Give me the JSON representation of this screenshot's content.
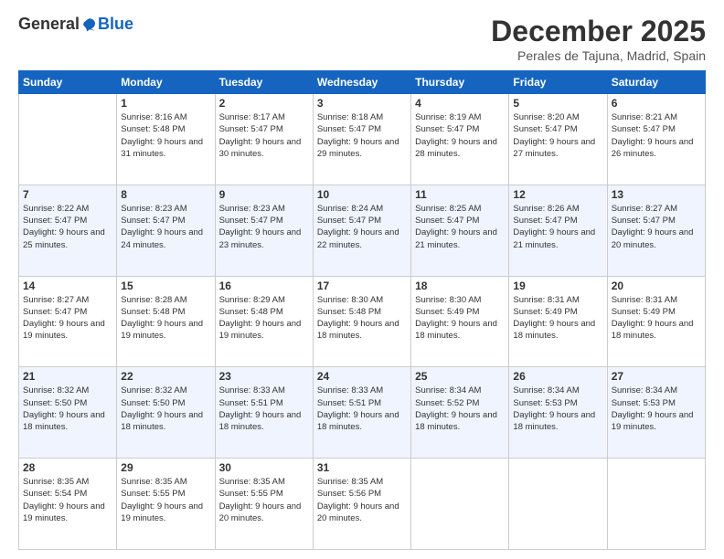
{
  "logo": {
    "general": "General",
    "blue": "Blue"
  },
  "header": {
    "month": "December 2025",
    "location": "Perales de Tajuna, Madrid, Spain"
  },
  "weekdays": [
    "Sunday",
    "Monday",
    "Tuesday",
    "Wednesday",
    "Thursday",
    "Friday",
    "Saturday"
  ],
  "weeks": [
    [
      {
        "day": "",
        "sunrise": "",
        "sunset": "",
        "daylight": "",
        "empty": true
      },
      {
        "day": "1",
        "sunrise": "Sunrise: 8:16 AM",
        "sunset": "Sunset: 5:48 PM",
        "daylight": "Daylight: 9 hours and 31 minutes."
      },
      {
        "day": "2",
        "sunrise": "Sunrise: 8:17 AM",
        "sunset": "Sunset: 5:47 PM",
        "daylight": "Daylight: 9 hours and 30 minutes."
      },
      {
        "day": "3",
        "sunrise": "Sunrise: 8:18 AM",
        "sunset": "Sunset: 5:47 PM",
        "daylight": "Daylight: 9 hours and 29 minutes."
      },
      {
        "day": "4",
        "sunrise": "Sunrise: 8:19 AM",
        "sunset": "Sunset: 5:47 PM",
        "daylight": "Daylight: 9 hours and 28 minutes."
      },
      {
        "day": "5",
        "sunrise": "Sunrise: 8:20 AM",
        "sunset": "Sunset: 5:47 PM",
        "daylight": "Daylight: 9 hours and 27 minutes."
      },
      {
        "day": "6",
        "sunrise": "Sunrise: 8:21 AM",
        "sunset": "Sunset: 5:47 PM",
        "daylight": "Daylight: 9 hours and 26 minutes."
      }
    ],
    [
      {
        "day": "7",
        "sunrise": "Sunrise: 8:22 AM",
        "sunset": "Sunset: 5:47 PM",
        "daylight": "Daylight: 9 hours and 25 minutes."
      },
      {
        "day": "8",
        "sunrise": "Sunrise: 8:23 AM",
        "sunset": "Sunset: 5:47 PM",
        "daylight": "Daylight: 9 hours and 24 minutes."
      },
      {
        "day": "9",
        "sunrise": "Sunrise: 8:23 AM",
        "sunset": "Sunset: 5:47 PM",
        "daylight": "Daylight: 9 hours and 23 minutes."
      },
      {
        "day": "10",
        "sunrise": "Sunrise: 8:24 AM",
        "sunset": "Sunset: 5:47 PM",
        "daylight": "Daylight: 9 hours and 22 minutes."
      },
      {
        "day": "11",
        "sunrise": "Sunrise: 8:25 AM",
        "sunset": "Sunset: 5:47 PM",
        "daylight": "Daylight: 9 hours and 21 minutes."
      },
      {
        "day": "12",
        "sunrise": "Sunrise: 8:26 AM",
        "sunset": "Sunset: 5:47 PM",
        "daylight": "Daylight: 9 hours and 21 minutes."
      },
      {
        "day": "13",
        "sunrise": "Sunrise: 8:27 AM",
        "sunset": "Sunset: 5:47 PM",
        "daylight": "Daylight: 9 hours and 20 minutes."
      }
    ],
    [
      {
        "day": "14",
        "sunrise": "Sunrise: 8:27 AM",
        "sunset": "Sunset: 5:47 PM",
        "daylight": "Daylight: 9 hours and 19 minutes."
      },
      {
        "day": "15",
        "sunrise": "Sunrise: 8:28 AM",
        "sunset": "Sunset: 5:48 PM",
        "daylight": "Daylight: 9 hours and 19 minutes."
      },
      {
        "day": "16",
        "sunrise": "Sunrise: 8:29 AM",
        "sunset": "Sunset: 5:48 PM",
        "daylight": "Daylight: 9 hours and 19 minutes."
      },
      {
        "day": "17",
        "sunrise": "Sunrise: 8:30 AM",
        "sunset": "Sunset: 5:48 PM",
        "daylight": "Daylight: 9 hours and 18 minutes."
      },
      {
        "day": "18",
        "sunrise": "Sunrise: 8:30 AM",
        "sunset": "Sunset: 5:49 PM",
        "daylight": "Daylight: 9 hours and 18 minutes."
      },
      {
        "day": "19",
        "sunrise": "Sunrise: 8:31 AM",
        "sunset": "Sunset: 5:49 PM",
        "daylight": "Daylight: 9 hours and 18 minutes."
      },
      {
        "day": "20",
        "sunrise": "Sunrise: 8:31 AM",
        "sunset": "Sunset: 5:49 PM",
        "daylight": "Daylight: 9 hours and 18 minutes."
      }
    ],
    [
      {
        "day": "21",
        "sunrise": "Sunrise: 8:32 AM",
        "sunset": "Sunset: 5:50 PM",
        "daylight": "Daylight: 9 hours and 18 minutes."
      },
      {
        "day": "22",
        "sunrise": "Sunrise: 8:32 AM",
        "sunset": "Sunset: 5:50 PM",
        "daylight": "Daylight: 9 hours and 18 minutes."
      },
      {
        "day": "23",
        "sunrise": "Sunrise: 8:33 AM",
        "sunset": "Sunset: 5:51 PM",
        "daylight": "Daylight: 9 hours and 18 minutes."
      },
      {
        "day": "24",
        "sunrise": "Sunrise: 8:33 AM",
        "sunset": "Sunset: 5:51 PM",
        "daylight": "Daylight: 9 hours and 18 minutes."
      },
      {
        "day": "25",
        "sunrise": "Sunrise: 8:34 AM",
        "sunset": "Sunset: 5:52 PM",
        "daylight": "Daylight: 9 hours and 18 minutes."
      },
      {
        "day": "26",
        "sunrise": "Sunrise: 8:34 AM",
        "sunset": "Sunset: 5:53 PM",
        "daylight": "Daylight: 9 hours and 18 minutes."
      },
      {
        "day": "27",
        "sunrise": "Sunrise: 8:34 AM",
        "sunset": "Sunset: 5:53 PM",
        "daylight": "Daylight: 9 hours and 19 minutes."
      }
    ],
    [
      {
        "day": "28",
        "sunrise": "Sunrise: 8:35 AM",
        "sunset": "Sunset: 5:54 PM",
        "daylight": "Daylight: 9 hours and 19 minutes."
      },
      {
        "day": "29",
        "sunrise": "Sunrise: 8:35 AM",
        "sunset": "Sunset: 5:55 PM",
        "daylight": "Daylight: 9 hours and 19 minutes."
      },
      {
        "day": "30",
        "sunrise": "Sunrise: 8:35 AM",
        "sunset": "Sunset: 5:55 PM",
        "daylight": "Daylight: 9 hours and 20 minutes."
      },
      {
        "day": "31",
        "sunrise": "Sunrise: 8:35 AM",
        "sunset": "Sunset: 5:56 PM",
        "daylight": "Daylight: 9 hours and 20 minutes."
      },
      {
        "day": "",
        "sunrise": "",
        "sunset": "",
        "daylight": "",
        "empty": true
      },
      {
        "day": "",
        "sunrise": "",
        "sunset": "",
        "daylight": "",
        "empty": true
      },
      {
        "day": "",
        "sunrise": "",
        "sunset": "",
        "daylight": "",
        "empty": true
      }
    ]
  ]
}
